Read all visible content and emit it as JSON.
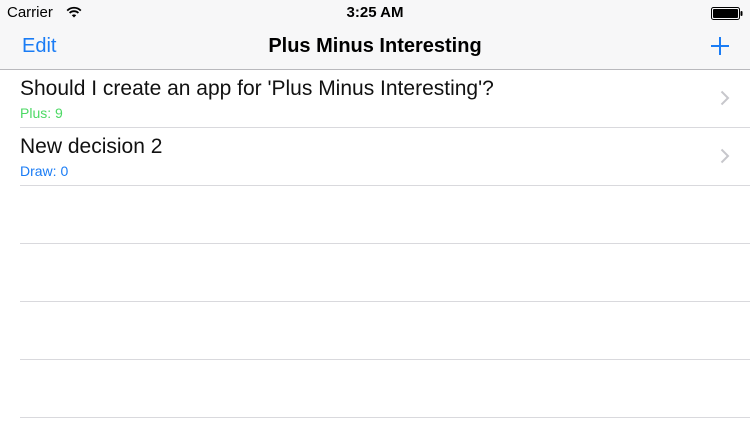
{
  "status_bar": {
    "carrier": "Carrier",
    "time": "3:25 AM"
  },
  "nav_bar": {
    "edit_label": "Edit",
    "title": "Plus Minus Interesting",
    "add_icon": "plus-icon"
  },
  "colors": {
    "accent": "#1a7cf5",
    "plus": "#4cd964",
    "draw": "#1a7cf5"
  },
  "decisions": [
    {
      "title": "Should I create an app for 'Plus Minus Interesting'?",
      "subtitle": "Plus: 9",
      "status": "plus"
    },
    {
      "title": "New decision 2",
      "subtitle": "Draw: 0",
      "status": "draw"
    }
  ]
}
